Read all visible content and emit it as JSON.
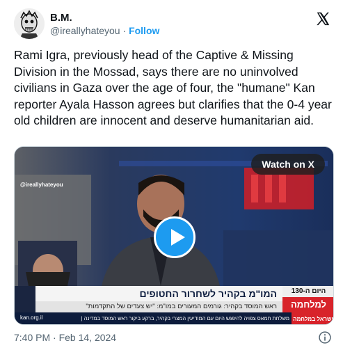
{
  "author": {
    "display_name": "B.M.",
    "handle": "@ireallyhateyou",
    "separator": "·",
    "follow_label": "Follow"
  },
  "tweet": {
    "text": "Rami Igra, previously head of the Captive & Missing Division in the Mossad, says there are no uninvolved civilians in Gaza over the age of four, the \"humane\" Kan reporter Ayala Hasson agrees but clarifies that the 0-4 year old children are innocent and deserve humanitarian aid."
  },
  "media": {
    "watch_label": "Watch on X",
    "watermark": "@ireallyhateyou",
    "headline": "המו\"מ בקהיר לשחרור החטופים",
    "subheadline": "ראש המוסד בקהיר: גורמים המעורים במו\"מ: \"יש צעדים של התקדמות\"",
    "war_day": "היום ה-130",
    "war_label": "למלחמה",
    "site": "kan.org.il",
    "ticker_text": "משלחת חמאס צפויה להיפגש היום עם המודיעין המצרי בקהיר, ברקע ביקור ראש המוסד במדינה | בן גביר לל",
    "ticker_tag": "ישראל במלחמה"
  },
  "footer": {
    "timestamp": "7:40 PM · Feb 14, 2024"
  },
  "colors": {
    "accent": "#1d9bf0",
    "text": "#0f1419",
    "muted": "#536471",
    "news_red": "#d8232a",
    "news_navy": "#0d1c3c"
  },
  "icons": {
    "brand": "x-logo-icon",
    "play": "play-icon",
    "info": "info-icon"
  }
}
